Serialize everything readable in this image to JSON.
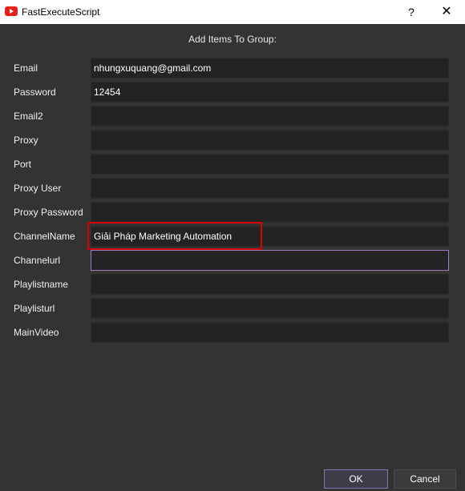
{
  "window": {
    "title": "FastExecuteScript",
    "help_glyph": "?",
    "close_glyph": "✕",
    "app_icon": "youtube-icon"
  },
  "heading": "Add Items To Group:",
  "fields": [
    {
      "label": "Email",
      "value": "nhungxuquang@gmail.com"
    },
    {
      "label": "Password",
      "value": "12454"
    },
    {
      "label": "Email2",
      "value": ""
    },
    {
      "label": "Proxy",
      "value": ""
    },
    {
      "label": "Port",
      "value": ""
    },
    {
      "label": "Proxy User",
      "value": ""
    },
    {
      "label": "Proxy Password",
      "value": ""
    },
    {
      "label": "ChannelName",
      "value": "Giải Pháp Marketing Automation"
    },
    {
      "label": "Channelurl",
      "value": ""
    },
    {
      "label": "Playlistname",
      "value": ""
    },
    {
      "label": "Playlisturl",
      "value": ""
    },
    {
      "label": "MainVideo",
      "value": ""
    }
  ],
  "buttons": {
    "ok": "OK",
    "cancel": "Cancel"
  },
  "colors": {
    "accent": "#9a7cbf",
    "highlight": "#d60000",
    "background": "#333333"
  }
}
